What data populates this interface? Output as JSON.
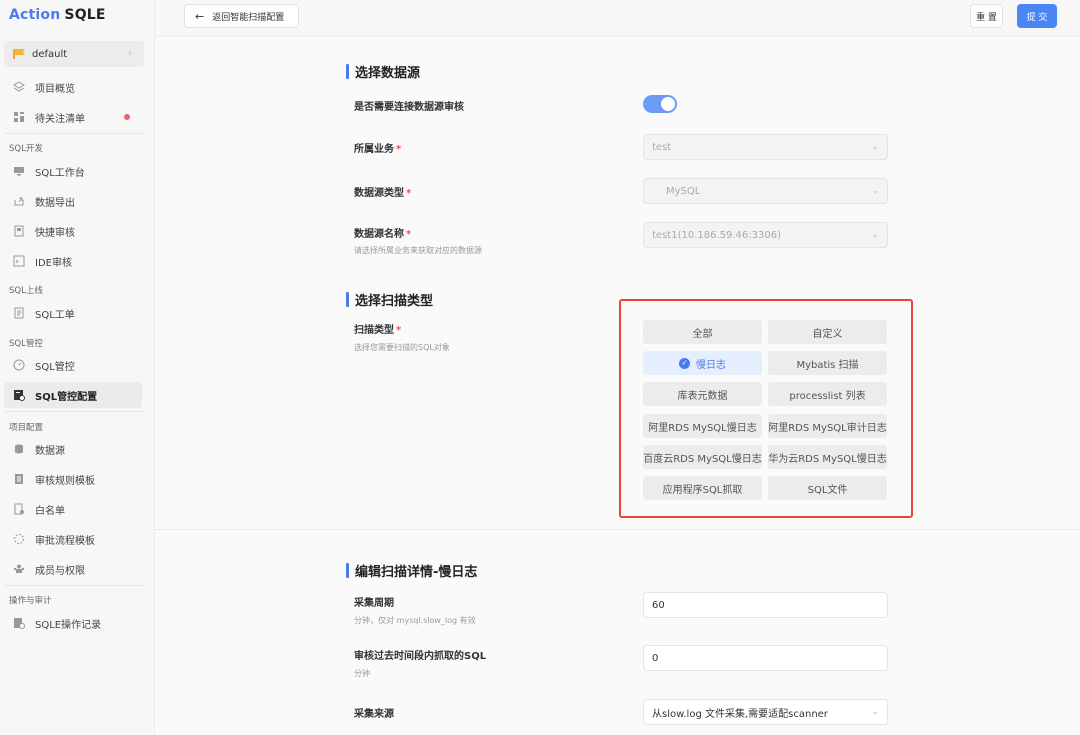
{
  "app": {
    "logo_a": "Action",
    "logo_b": "SQLE"
  },
  "project": {
    "name": "default"
  },
  "sidebar": {
    "items": [
      {
        "label": "项目概览"
      },
      {
        "label": "待关注清单"
      }
    ],
    "sections": [
      {
        "title": "SQL开发",
        "items": [
          "SQL工作台",
          "数据导出",
          "快捷审核",
          "IDE审核"
        ]
      },
      {
        "title": "SQL上线",
        "items": [
          "SQL工单"
        ]
      },
      {
        "title": "SQL管控",
        "items": [
          "SQL管控",
          "SQL管控配置"
        ]
      },
      {
        "title": "项目配置",
        "items": [
          "数据源",
          "审核规则模板",
          "白名单",
          "审批流程模板",
          "成员与权限"
        ]
      },
      {
        "title": "操作与审计",
        "items": [
          "SQLE操作记录"
        ]
      }
    ]
  },
  "toolbar": {
    "back_label": "返回智能扫描配置",
    "reset_label": "重 置",
    "submit_label": "提 交"
  },
  "datasource": {
    "title": "选择数据源",
    "connect_label": "是否需要连接数据源审核",
    "connect_enabled": true,
    "business_label": "所属业务",
    "business_value": "test",
    "dbtype_label": "数据源类型",
    "dbtype_value": "MySQL",
    "dbname_label": "数据源名称",
    "dbname_hint": "请选择所属业务来获取对应的数据源",
    "dbname_value": "test1(10.186.59.46:3306)"
  },
  "scan": {
    "title": "选择扫描类型",
    "label": "扫描类型",
    "hint": "选择您需要扫描的SQL对象",
    "options": [
      "全部",
      "自定义",
      "慢日志",
      "Mybatis 扫描",
      "库表元数据",
      "processlist 列表",
      "阿里RDS MySQL慢日志",
      "阿里RDS MySQL审计日志",
      "百度云RDS MySQL慢日志",
      "华为云RDS MySQL慢日志",
      "应用程序SQL抓取",
      "SQL文件"
    ],
    "selected": "慢日志"
  },
  "detail": {
    "title": "编辑扫描详情-慢日志",
    "period_label": "采集周期",
    "period_hint": "分钟，仅对 mysql.slow_log 有效",
    "period_value": "60",
    "past_label": "审核过去时间段内抓取的SQL",
    "past_hint": "分钟",
    "past_value": "0",
    "source_label": "采集来源",
    "source_value": "从slow.log 文件采集,需要适配scanner"
  },
  "colors": {
    "accent": "#4a7cf0",
    "highlight_box": "#e8463c",
    "required": "#f25353"
  }
}
